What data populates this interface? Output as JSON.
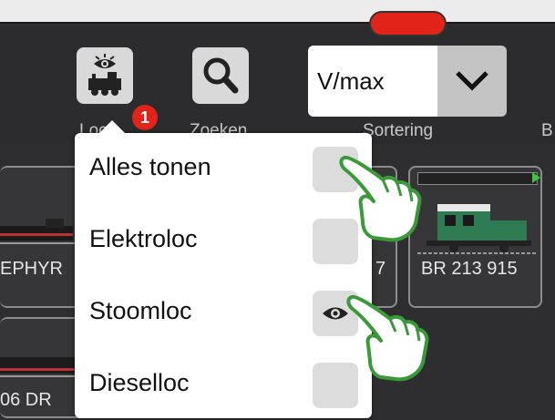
{
  "toolbar": {
    "locs_label": "Locs",
    "locs_badge": "1",
    "search_label": "Zoeken",
    "sort_label": "Sortering",
    "sort_value": "V/max",
    "partial_label": "B"
  },
  "cards": {
    "left_top_caption": "EPHYR",
    "left_bottom_caption": "06 DR",
    "middle_caption": "7",
    "right_caption": "BR 213 915"
  },
  "menu": {
    "items": [
      {
        "label": "Alles tonen",
        "checked": false
      },
      {
        "label": "Elektroloc",
        "checked": false
      },
      {
        "label": "Stoomloc",
        "checked": true
      },
      {
        "label": "Dieselloc",
        "checked": false
      }
    ]
  },
  "colors": {
    "accent_red": "#e2231a",
    "hand_green": "#3a9a3a",
    "progress_green": "#3cc43c"
  },
  "icons": {
    "locs": "eye-over-locomotive-icon",
    "search": "magnifier-icon",
    "sort": "chevron-down-icon",
    "checked": "eye-icon",
    "pointer": "pointing-hand-icon"
  }
}
